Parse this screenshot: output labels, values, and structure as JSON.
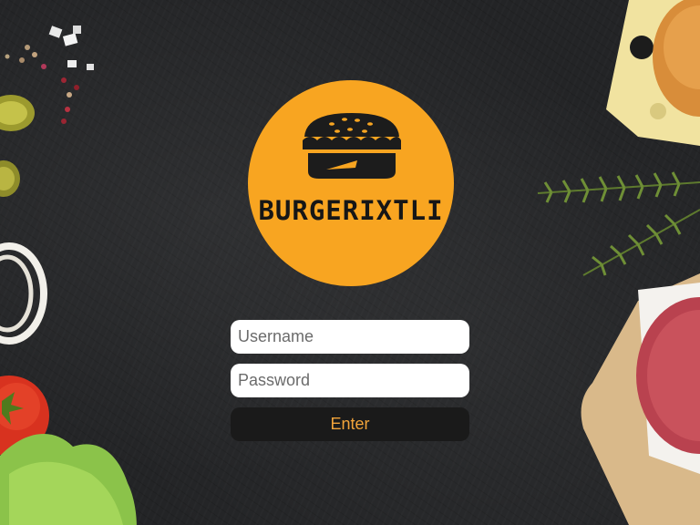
{
  "logo": {
    "brand_name": "BURGERIXTLI",
    "icon": "burger-icon"
  },
  "form": {
    "username_placeholder": "Username",
    "password_placeholder": "Password",
    "enter_label": "Enter"
  },
  "colors": {
    "background": "#232426",
    "logo_circle": "#F8A521",
    "logo_ink": "#161616",
    "field_bg": "#FFFFFF",
    "button_bg": "#1A1A1A",
    "button_text": "#F2A43A"
  },
  "decorations": [
    "peppercorns-and-salt",
    "pickle-slices",
    "onion-rings",
    "tomato",
    "lettuce",
    "cheese-slice",
    "burger-bun",
    "rosemary",
    "raw-patty-on-board"
  ]
}
